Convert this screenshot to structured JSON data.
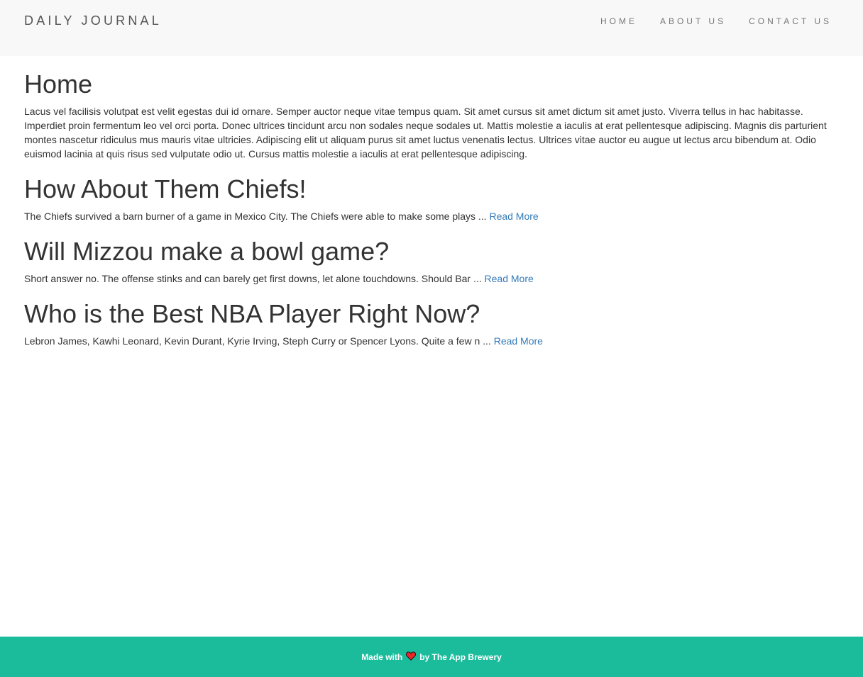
{
  "header": {
    "brand": "DAILY JOURNAL",
    "nav": [
      {
        "label": "HOME"
      },
      {
        "label": "ABOUT US"
      },
      {
        "label": "CONTACT US"
      }
    ]
  },
  "home": {
    "title": "Home",
    "content": "Lacus vel facilisis volutpat est velit egestas dui id ornare. Semper auctor neque vitae tempus quam. Sit amet cursus sit amet dictum sit amet justo. Viverra tellus in hac habitasse. Imperdiet proin fermentum leo vel orci porta. Donec ultrices tincidunt arcu non sodales neque sodales ut. Mattis molestie a iaculis at erat pellentesque adipiscing. Magnis dis parturient montes nascetur ridiculus mus mauris vitae ultricies. Adipiscing elit ut aliquam purus sit amet luctus venenatis lectus. Ultrices vitae auctor eu augue ut lectus arcu bibendum at. Odio euismod lacinia at quis risus sed vulputate odio ut. Cursus mattis molestie a iaculis at erat pellentesque adipiscing."
  },
  "posts": [
    {
      "title": "How About Them Chiefs!",
      "excerpt": "The Chiefs survived a barn burner of a game in Mexico City. The Chiefs were able to make some plays ... ",
      "read_more": "Read More"
    },
    {
      "title": "Will Mizzou make a bowl game?",
      "excerpt": "Short answer no. The offense stinks and can barely get first downs, let alone touchdowns. Should Bar ... ",
      "read_more": "Read More"
    },
    {
      "title": "Who is the Best NBA Player Right Now?",
      "excerpt": "Lebron James, Kawhi Leonard, Kevin Durant, Kyrie Irving, Steph Curry or Spencer Lyons. Quite a few n ... ",
      "read_more": "Read More"
    }
  ],
  "footer": {
    "made_with": "Made with",
    "heart_icon": "heart-icon",
    "by": "by The App Brewery"
  },
  "colors": {
    "navbar_bg": "#f8f8f8",
    "footer_bg": "#1abc9c",
    "link": "#337ab7",
    "heart": "#e8262b"
  }
}
